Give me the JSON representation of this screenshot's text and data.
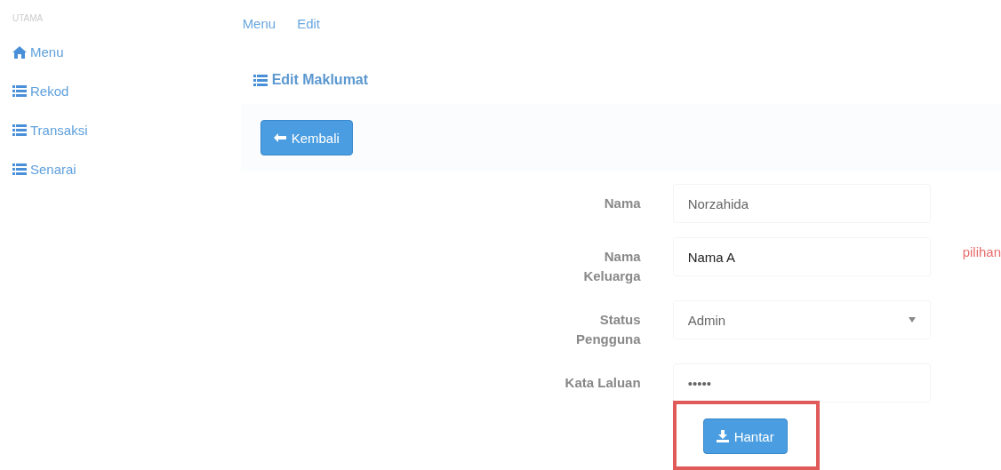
{
  "sidebar": {
    "heading": "UTAMA",
    "items": [
      {
        "label": "Menu",
        "kind": "home"
      },
      {
        "label": "Rekod",
        "kind": "list"
      },
      {
        "label": "Transaksi",
        "kind": "list"
      },
      {
        "label": "Senarai",
        "kind": "list"
      }
    ]
  },
  "breadcrumb": [
    "Menu",
    "Edit"
  ],
  "page_title": "Edit Maklumat",
  "back_button": "Kembali",
  "form": {
    "fields": [
      {
        "label": "Nama",
        "kind": "text",
        "value": "Norzahida"
      },
      {
        "label": "Nama Keluarga",
        "kind": "text",
        "value": "Nama A",
        "note": "pilihan"
      },
      {
        "label": "Status Pengguna",
        "kind": "select",
        "value": "Admin"
      },
      {
        "label": "Kata Laluan",
        "kind": "password",
        "value": "•••••"
      }
    ]
  },
  "submit_button": {
    "label": "Hantar",
    "highlighted": true
  }
}
